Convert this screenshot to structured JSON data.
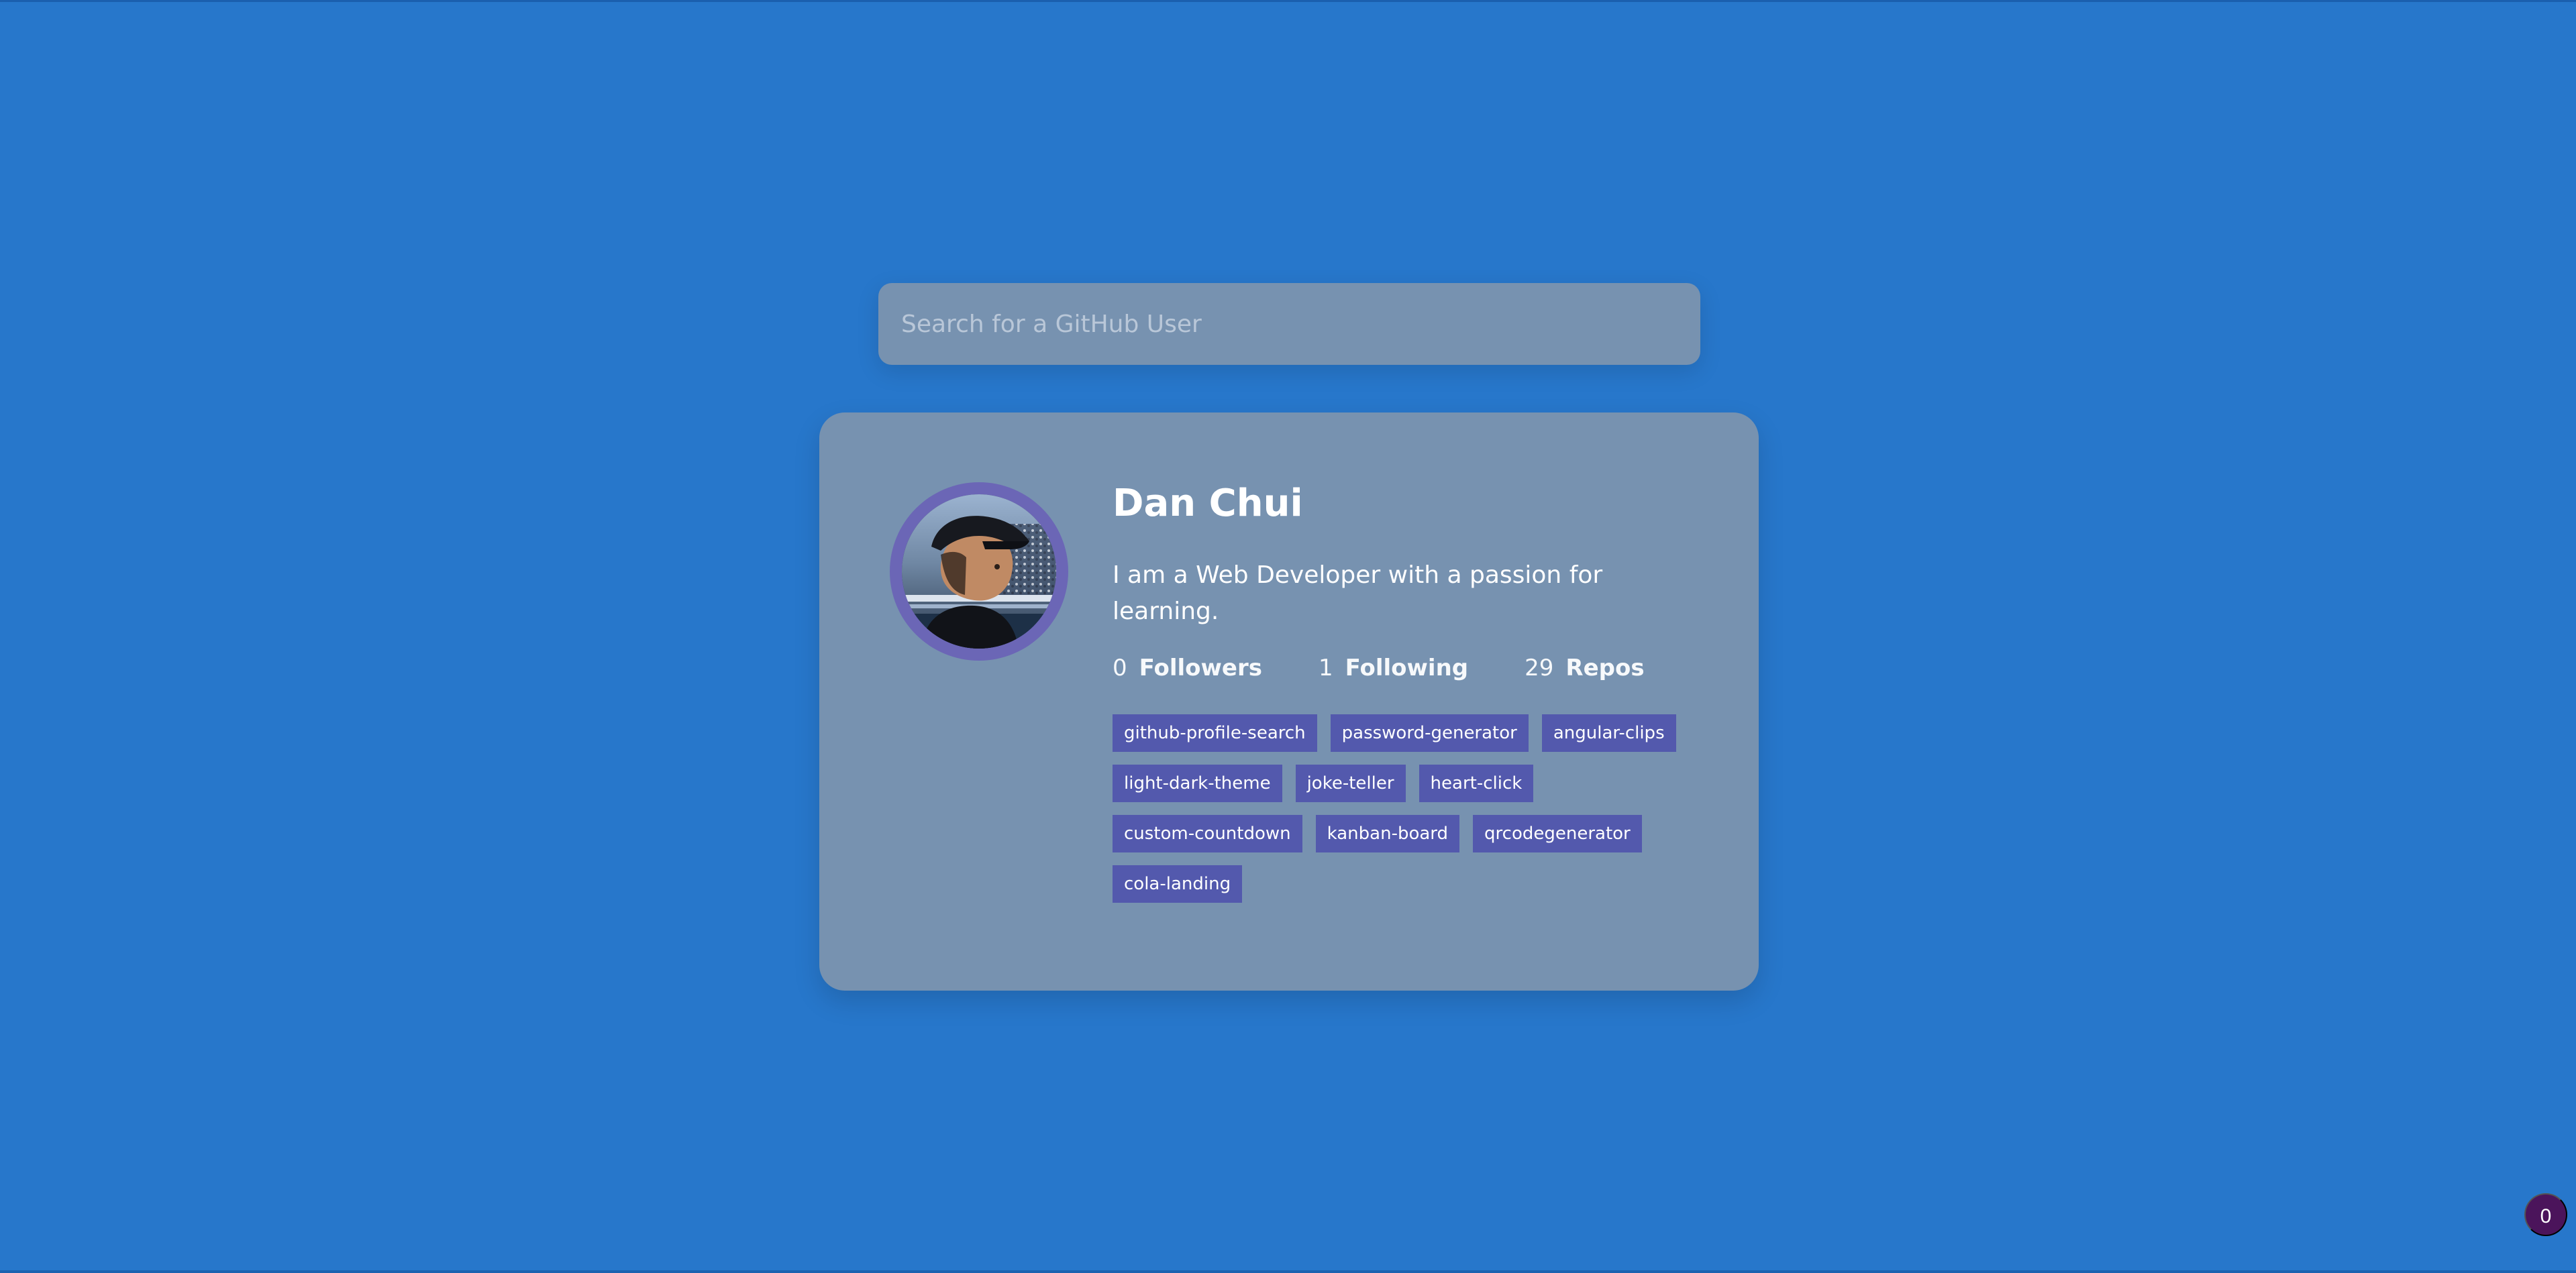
{
  "search": {
    "placeholder": "Search for a GitHub User"
  },
  "profile": {
    "name": "Dan Chui",
    "bio": "I am a Web Developer with a passion for learning.",
    "stats": {
      "followers": {
        "value": "0",
        "label": "Followers"
      },
      "following": {
        "value": "1",
        "label": "Following"
      },
      "repos": {
        "value": "29",
        "label": "Repos"
      }
    },
    "repos": [
      "github-profile-search",
      "password-generator",
      "angular-clips",
      "light-dark-theme",
      "joke-teller",
      "heart-click",
      "custom-countdown",
      "kanban-board",
      "qrcodegenerator",
      "cola-landing"
    ]
  },
  "badge": {
    "count": "0"
  },
  "colors": {
    "background": "#2777cb",
    "card": "#7792b0",
    "repo_tag": "#5359ad",
    "avatar_ring": "#6b66b6",
    "badge": "#4b145b"
  }
}
